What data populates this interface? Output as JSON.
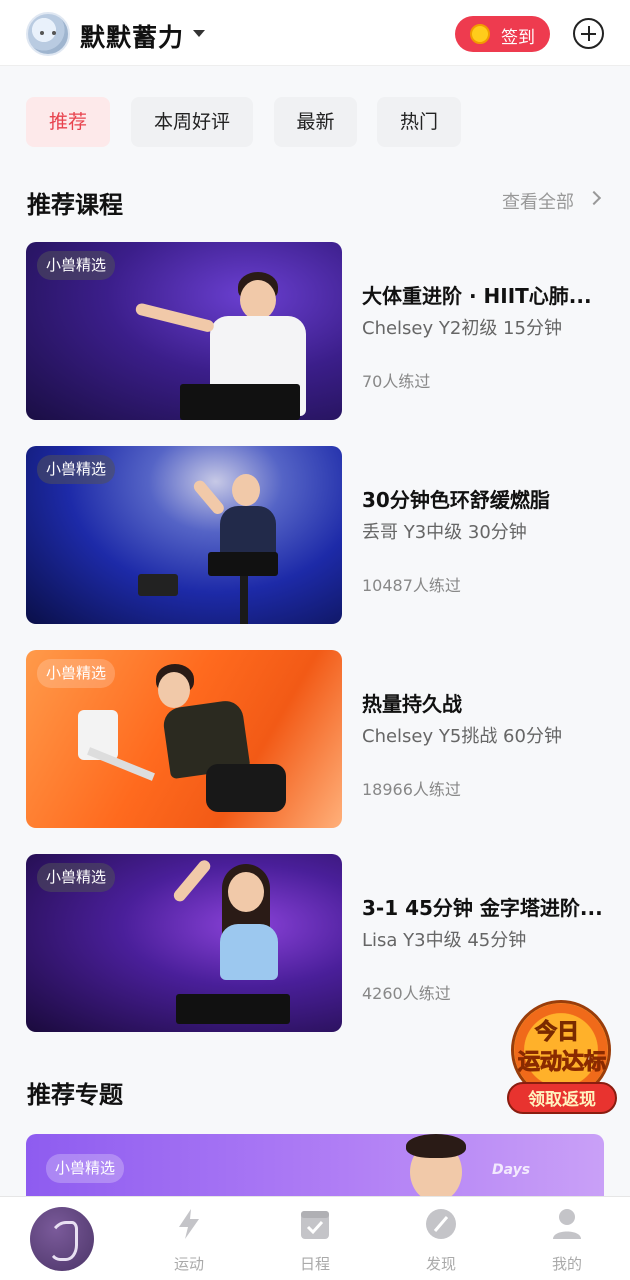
{
  "header": {
    "username": "默默蓄力",
    "signin_label": "签到"
  },
  "filters": [
    {
      "label": "推荐",
      "active": true
    },
    {
      "label": "本周好评",
      "active": false
    },
    {
      "label": "最新",
      "active": false
    },
    {
      "label": "热门",
      "active": false
    }
  ],
  "recommended_courses": {
    "title": "推荐课程",
    "see_all": "查看全部",
    "items": [
      {
        "badge": "小兽精选",
        "title": "大体重进阶 · HIIT心肺...",
        "subtitle": "Chelsey Y2初级 15分钟",
        "count": "70人练过"
      },
      {
        "badge": "小兽精选",
        "title": "30分钟色环舒缓燃脂",
        "subtitle": "丢哥 Y3中级 30分钟",
        "count": "10487人练过"
      },
      {
        "badge": "小兽精选",
        "title": "热量持久战",
        "subtitle": "Chelsey Y5挑战 60分钟",
        "count": "18966人练过"
      },
      {
        "badge": "小兽精选",
        "title": "3-1 45分钟 金字塔进阶...",
        "subtitle": "Lisa Y3中级 45分钟",
        "count": "4260人练过"
      }
    ]
  },
  "recommended_topics": {
    "title": "推荐专题",
    "banner_badge": "小兽精选",
    "banner_text": "Days"
  },
  "promo": {
    "line1": "今日",
    "line2": "运动达标",
    "button": "领取返现"
  },
  "tabbar": [
    {
      "label": "",
      "icon": "home-logo-icon"
    },
    {
      "label": "运动",
      "icon": "lightning-icon"
    },
    {
      "label": "日程",
      "icon": "calendar-icon"
    },
    {
      "label": "发现",
      "icon": "compass-icon"
    },
    {
      "label": "我的",
      "icon": "profile-icon"
    }
  ],
  "colors": {
    "accent": "#ee3b4f",
    "active_chip_bg": "#fde9ea",
    "active_chip_text": "#e8434e"
  }
}
